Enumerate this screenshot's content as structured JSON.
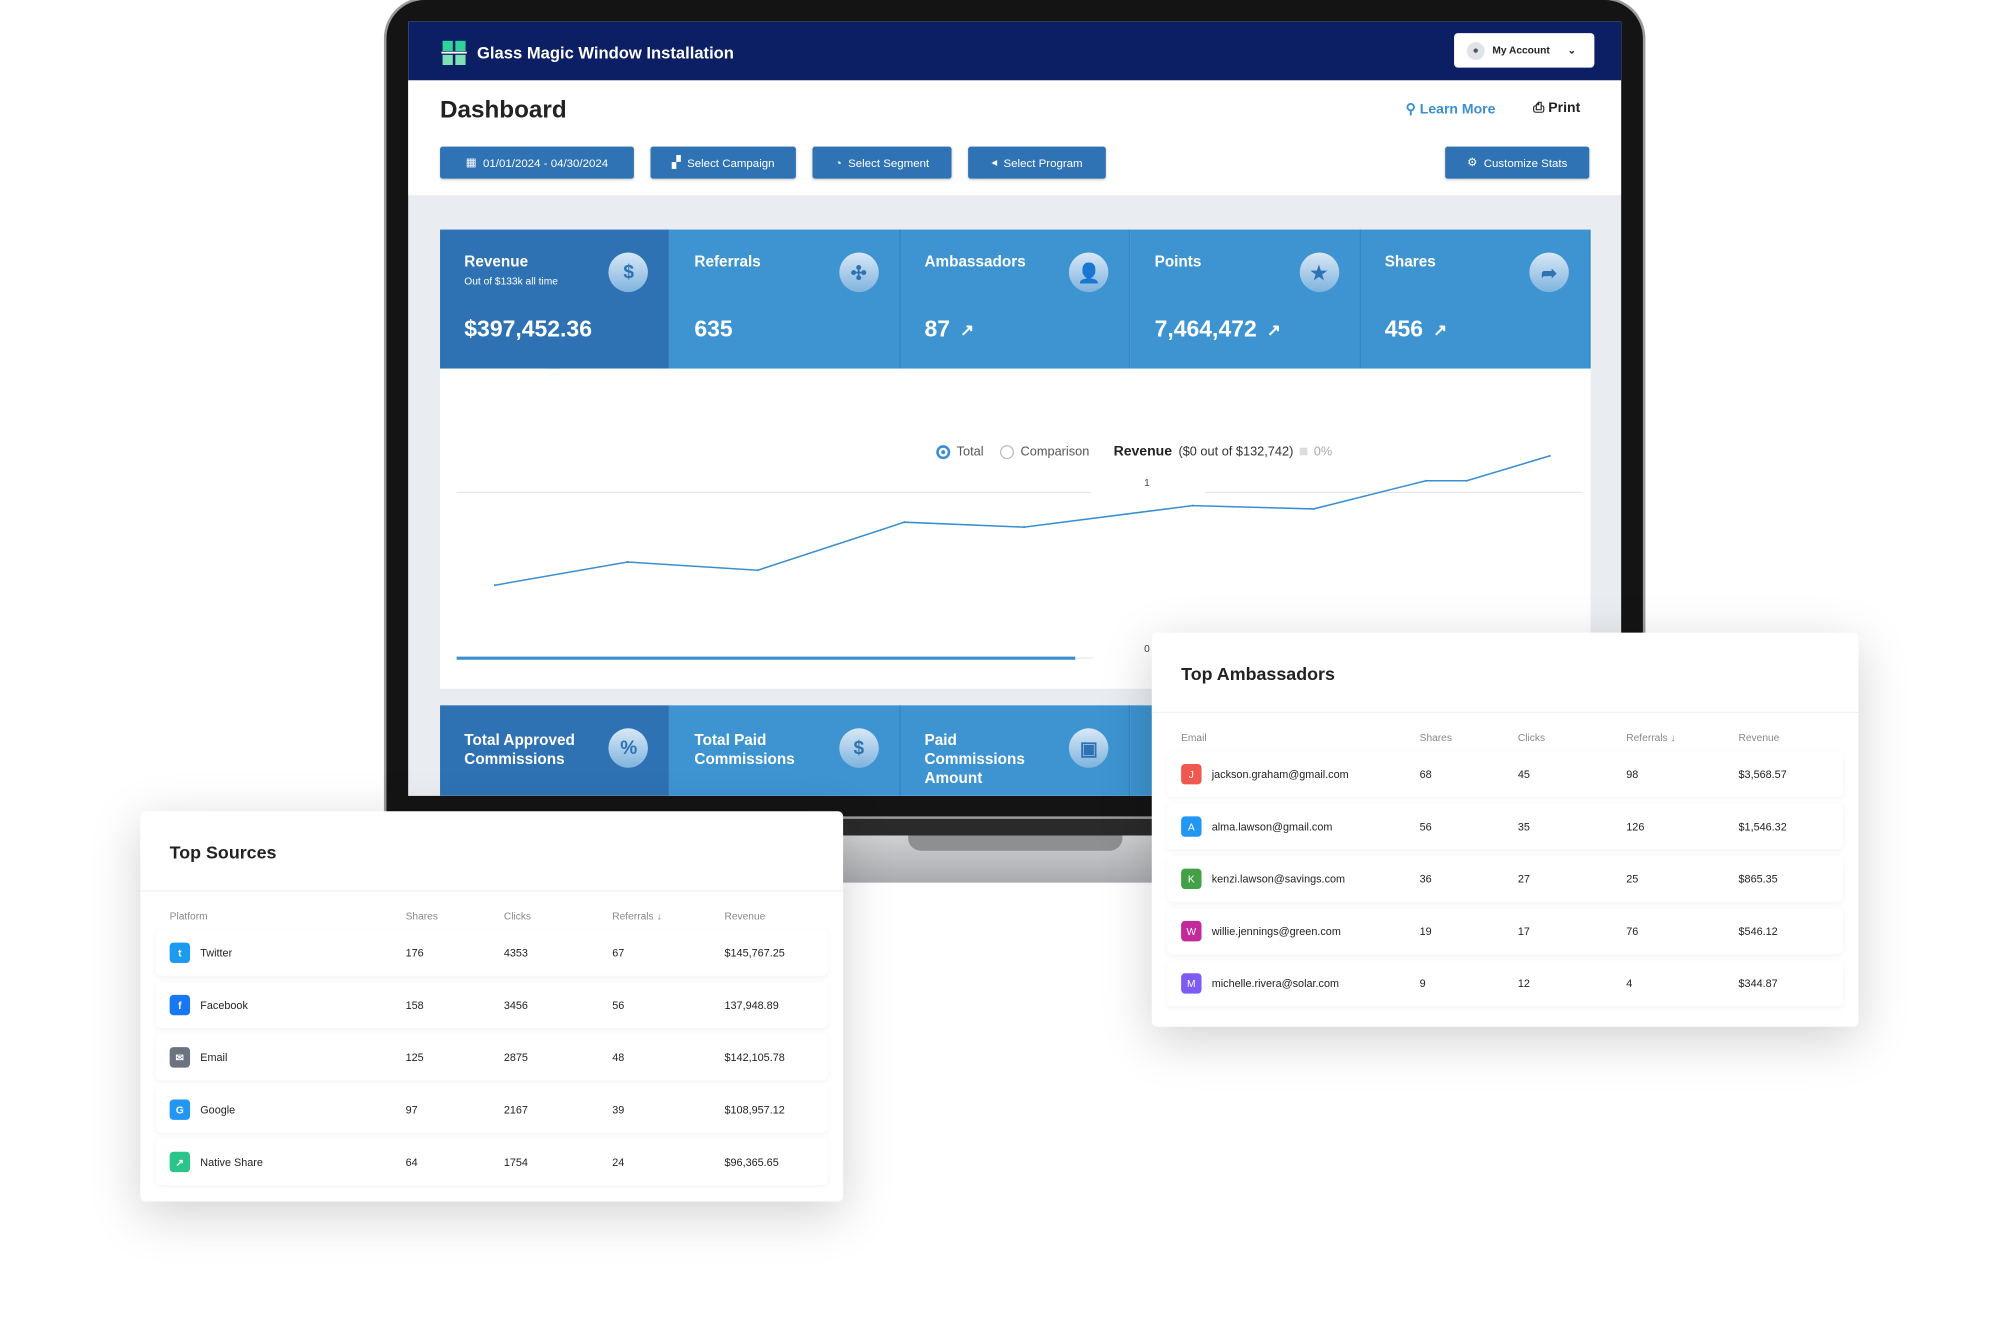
{
  "header": {
    "app_title": "Glass Magic Window Installation",
    "account_label": "My Account"
  },
  "page": {
    "title": "Dashboard",
    "learn_more": "Learn More",
    "print": "Print"
  },
  "toolbar": {
    "date_range": "01/01/2024 - 04/30/2024",
    "campaign": "Select Campaign",
    "segment": "Select Segment",
    "program": "Select Program",
    "customize": "Customize Stats"
  },
  "stats": [
    {
      "label": "Revenue",
      "sub": "Out of $133k all time",
      "value": "$397,452.36",
      "icon": "dollar-icon",
      "trend": false
    },
    {
      "label": "Referrals",
      "value": "635",
      "icon": "network-icon",
      "trend": false
    },
    {
      "label": "Ambassadors",
      "value": "87",
      "icon": "users-icon",
      "trend": true
    },
    {
      "label": "Points",
      "value": "7,464,472",
      "icon": "star-icon",
      "trend": true
    },
    {
      "label": "Shares",
      "value": "456",
      "icon": "share-icon",
      "trend": true
    }
  ],
  "bottom_stats": [
    {
      "label": "Total Approved Commissions",
      "icon": "percent-hand-icon"
    },
    {
      "label": "Total Paid Commissions",
      "icon": "dollar-hand-icon"
    },
    {
      "label": "Paid Commissions Amount",
      "icon": "money-icon"
    }
  ],
  "chart_data": {
    "type": "line",
    "legend": {
      "total": "Total",
      "comparison": "Comparison",
      "selected": "Total"
    },
    "title": "Revenue",
    "title_detail": "($0 out of $132,742)",
    "percent": "0%",
    "y_ticks": [
      "1",
      "0"
    ],
    "ylim": [
      0,
      1.3
    ],
    "series": [
      {
        "values": [
          0.44,
          0.58,
          0.53,
          0.82,
          0.79,
          0.92,
          0.9,
          1.07,
          1.07,
          1.22
        ]
      }
    ],
    "grid": true,
    "color": "#3a8fd0"
  },
  "top_ambassadors": {
    "title": "Top Ambassadors",
    "columns": [
      "Email",
      "Shares",
      "Clicks",
      "Referrals",
      "Revenue"
    ],
    "rows": [
      {
        "initial": "J",
        "color": "#f0584f",
        "email": "jackson.graham@gmail.com",
        "shares": "68",
        "clicks": "45",
        "referrals": "98",
        "revenue": "$3,568.57"
      },
      {
        "initial": "A",
        "color": "#2196f3",
        "email": "alma.lawson@gmail.com",
        "shares": "56",
        "clicks": "35",
        "referrals": "126",
        "revenue": "$1,546.32"
      },
      {
        "initial": "K",
        "color": "#43a047",
        "email": "kenzi.lawson@savings.com",
        "shares": "36",
        "clicks": "27",
        "referrals": "25",
        "revenue": "$865.35"
      },
      {
        "initial": "W",
        "color": "#c2299b",
        "email": "willie.jennings@green.com",
        "shares": "19",
        "clicks": "17",
        "referrals": "76",
        "revenue": "$546.12"
      },
      {
        "initial": "M",
        "color": "#7c5cf2",
        "email": "michelle.rivera@solar.com",
        "shares": "9",
        "clicks": "12",
        "referrals": "4",
        "revenue": "$344.87"
      }
    ]
  },
  "top_sources": {
    "title": "Top Sources",
    "columns": [
      "Platform",
      "Shares",
      "Clicks",
      "Referrals",
      "Revenue"
    ],
    "rows": [
      {
        "platform": "Twitter",
        "icon": "twitter-icon",
        "glyph": "t",
        "color": "#1d9bf0",
        "shares": "176",
        "clicks": "4353",
        "referrals": "67",
        "revenue": "$145,767.25"
      },
      {
        "platform": "Facebook",
        "icon": "facebook-icon",
        "glyph": "f",
        "color": "#1877f2",
        "shares": "158",
        "clicks": "3456",
        "referrals": "56",
        "revenue": "137,948.89"
      },
      {
        "platform": "Email",
        "icon": "email-icon",
        "glyph": "✉",
        "color": "#6b7280",
        "shares": "125",
        "clicks": "2875",
        "referrals": "48",
        "revenue": "$142,105.78"
      },
      {
        "platform": "Google",
        "icon": "google-icon",
        "glyph": "G",
        "color": "#2196f3",
        "shares": "97",
        "clicks": "2167",
        "referrals": "39",
        "revenue": "$108,957.12"
      },
      {
        "platform": "Native Share",
        "icon": "native-share-icon",
        "glyph": "↗",
        "color": "#2bc48a",
        "shares": "64",
        "clicks": "1754",
        "referrals": "24",
        "revenue": "$96,365.65"
      }
    ]
  }
}
